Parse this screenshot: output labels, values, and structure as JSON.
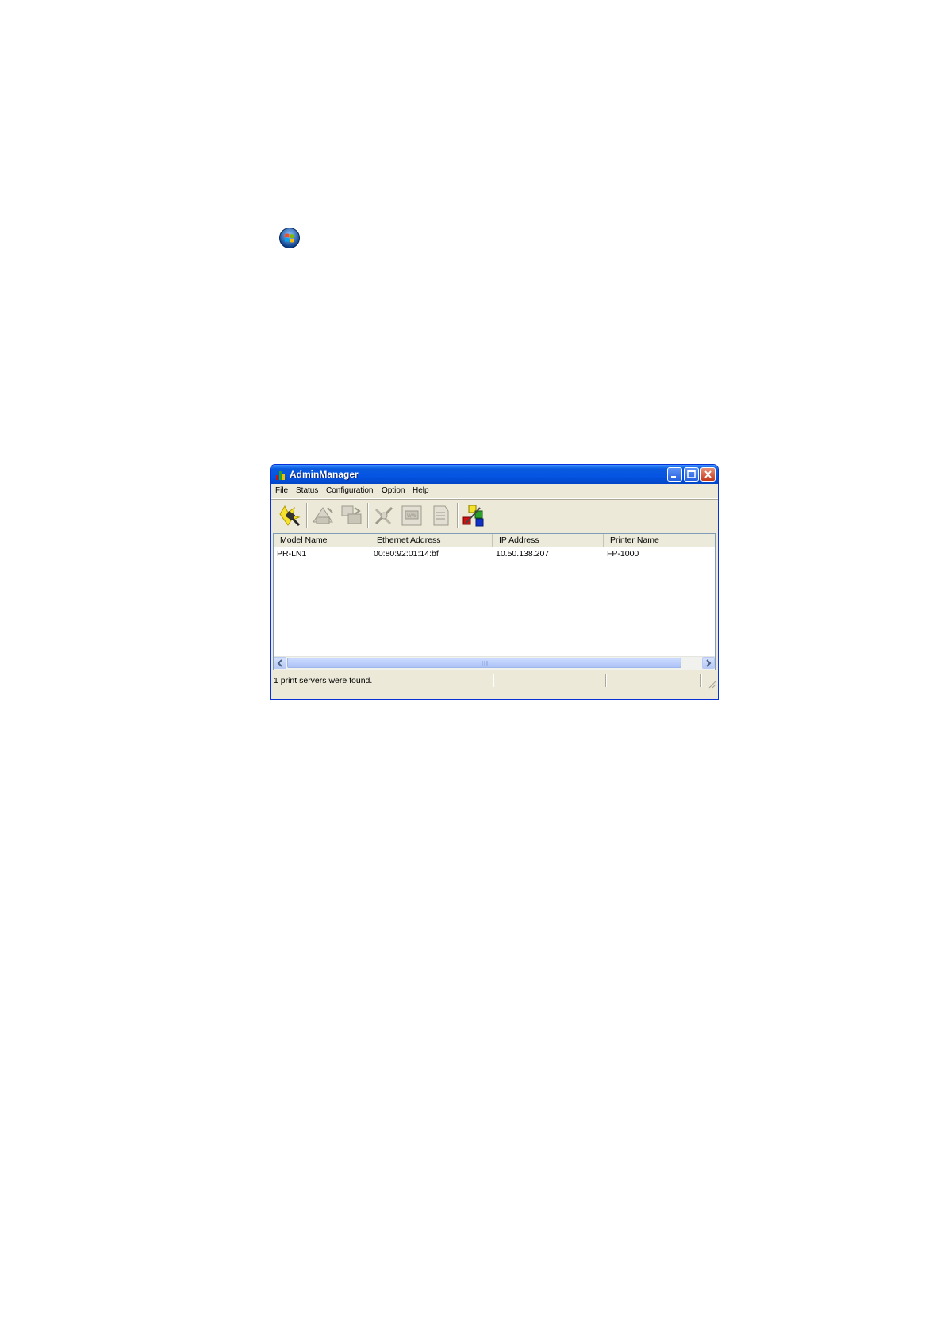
{
  "window": {
    "title": "AdminManager",
    "colors": {
      "titlebar": "#0554e3",
      "face": "#ece9d8",
      "border": "#0831d9"
    }
  },
  "menu": [
    {
      "label": "File"
    },
    {
      "label": "Status"
    },
    {
      "label": "Configuration"
    },
    {
      "label": "Option"
    },
    {
      "label": "Help"
    }
  ],
  "toolbar": [
    {
      "icon": "search-device-icon",
      "enabled": true
    },
    {
      "icon": "network-config-icon",
      "enabled": false
    },
    {
      "icon": "device-settings-icon",
      "enabled": false
    },
    {
      "icon": "tools-icon",
      "enabled": false
    },
    {
      "icon": "web-config-icon",
      "enabled": false
    },
    {
      "icon": "report-icon",
      "enabled": false
    },
    {
      "icon": "color-settings-icon",
      "enabled": true
    }
  ],
  "table": {
    "columns": [
      "Model Name",
      "Ethernet Address",
      "IP Address",
      "Printer Name"
    ],
    "rows": [
      [
        "PR-LN1",
        "00:80:92:01:14:bf",
        "10.50.138.207",
        "FP-1000"
      ]
    ]
  },
  "status": {
    "text": "1 print servers were found."
  },
  "desktop": {
    "start_orb_icon": "windows-start-orb-icon"
  }
}
